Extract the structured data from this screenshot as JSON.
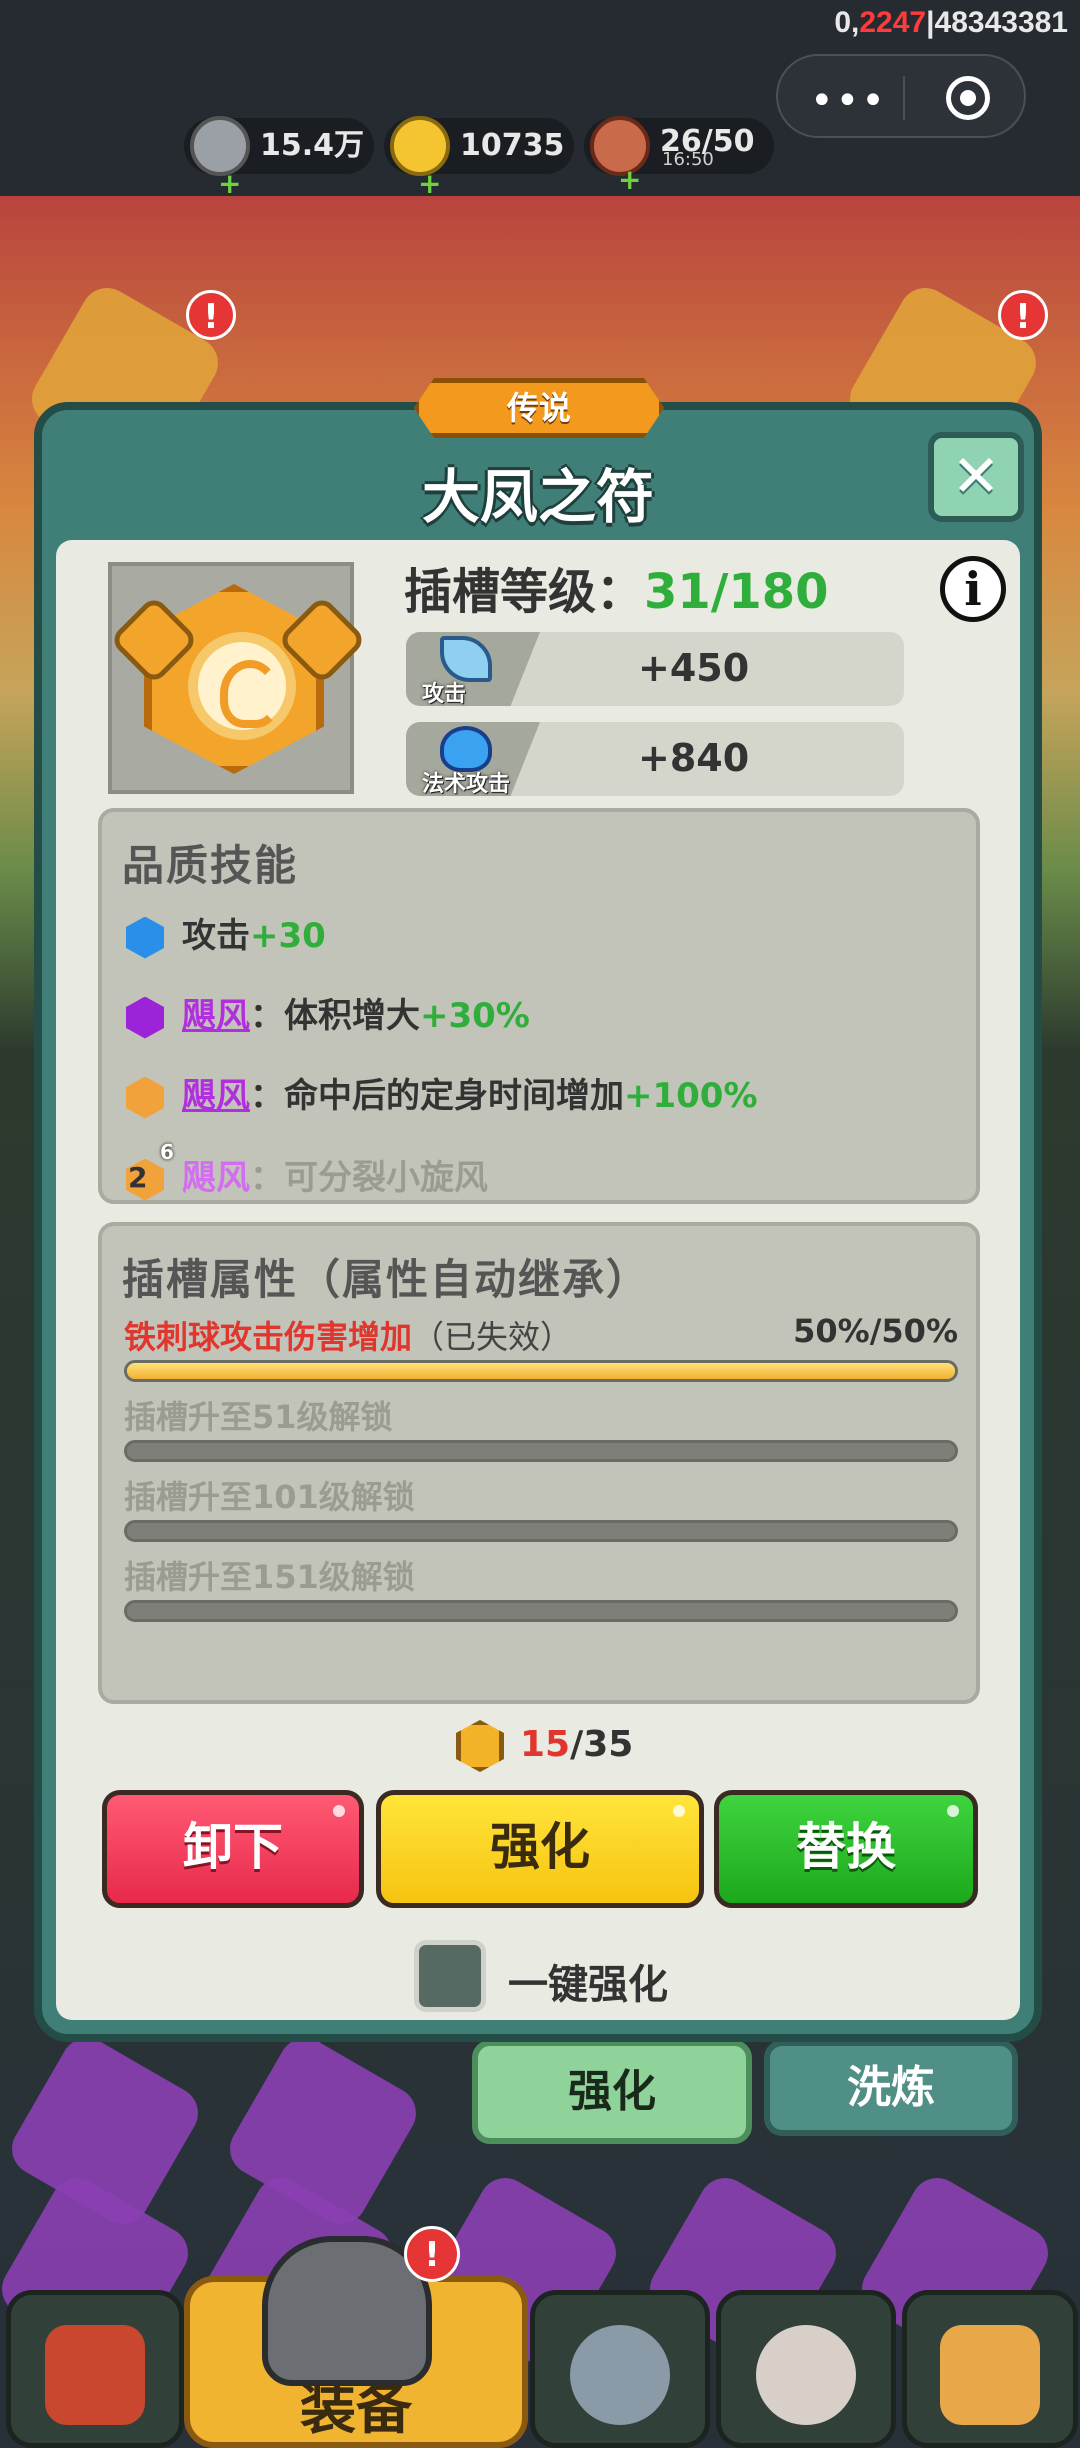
{
  "status": {
    "debug_prefix": "0,",
    "debug_red": "2247",
    "debug_suffix": "|48343381"
  },
  "resources": [
    {
      "value": "15.4万",
      "icon": "silver-coin-icon"
    },
    {
      "value": "10735",
      "icon": "gold-ingot-icon"
    },
    {
      "value": "26/50",
      "sub": "16:50",
      "icon": "meat-stamina-icon"
    }
  ],
  "dialog": {
    "rarity": "传说",
    "title": "大凤之符",
    "slot_level_label": "插槽等级：",
    "slot_level_value": "31/180",
    "stats": [
      {
        "label": "攻击",
        "value": "+450",
        "icon": "sword-icon"
      },
      {
        "label": "法术攻击",
        "value": "+840",
        "icon": "blue-flame-icon"
      }
    ],
    "quality_title": "品质技能",
    "skills": [
      {
        "text": "攻击",
        "bonus": "+30",
        "color": "#2a8fe8"
      },
      {
        "name": "飓风",
        "text": "：体积增大",
        "bonus": "+30%",
        "color": "#9c23d8"
      },
      {
        "name": "飓风",
        "text": "：命中后的定身时间增加",
        "bonus": "+100%",
        "color": "#f2a23a"
      },
      {
        "lock_num": "2",
        "lock_sup": "6",
        "name": "飓风",
        "text": "：可分裂小旋风",
        "color": "#f2a23a"
      }
    ],
    "slot_title": "插槽属性（属性自动继承）",
    "slot_attrs": [
      {
        "label": "铁刺球攻击伤害增加",
        "note": "（已失效）",
        "percent": "50%/50%",
        "fill": 1.0
      },
      {
        "label": "插槽升至51级解锁",
        "fill": 0
      },
      {
        "label": "插槽升至101级解锁",
        "fill": 0
      },
      {
        "label": "插槽升至151级解锁",
        "fill": 0
      }
    ],
    "cost_current": "15",
    "cost_total": "/35",
    "buttons": {
      "unload": "卸下",
      "enhance": "强化",
      "replace": "替换"
    },
    "onekey_label": "一键强化"
  },
  "tabs": {
    "enhance": "强化",
    "refine": "洗炼"
  },
  "nav": {
    "equip_label": "装备"
  }
}
